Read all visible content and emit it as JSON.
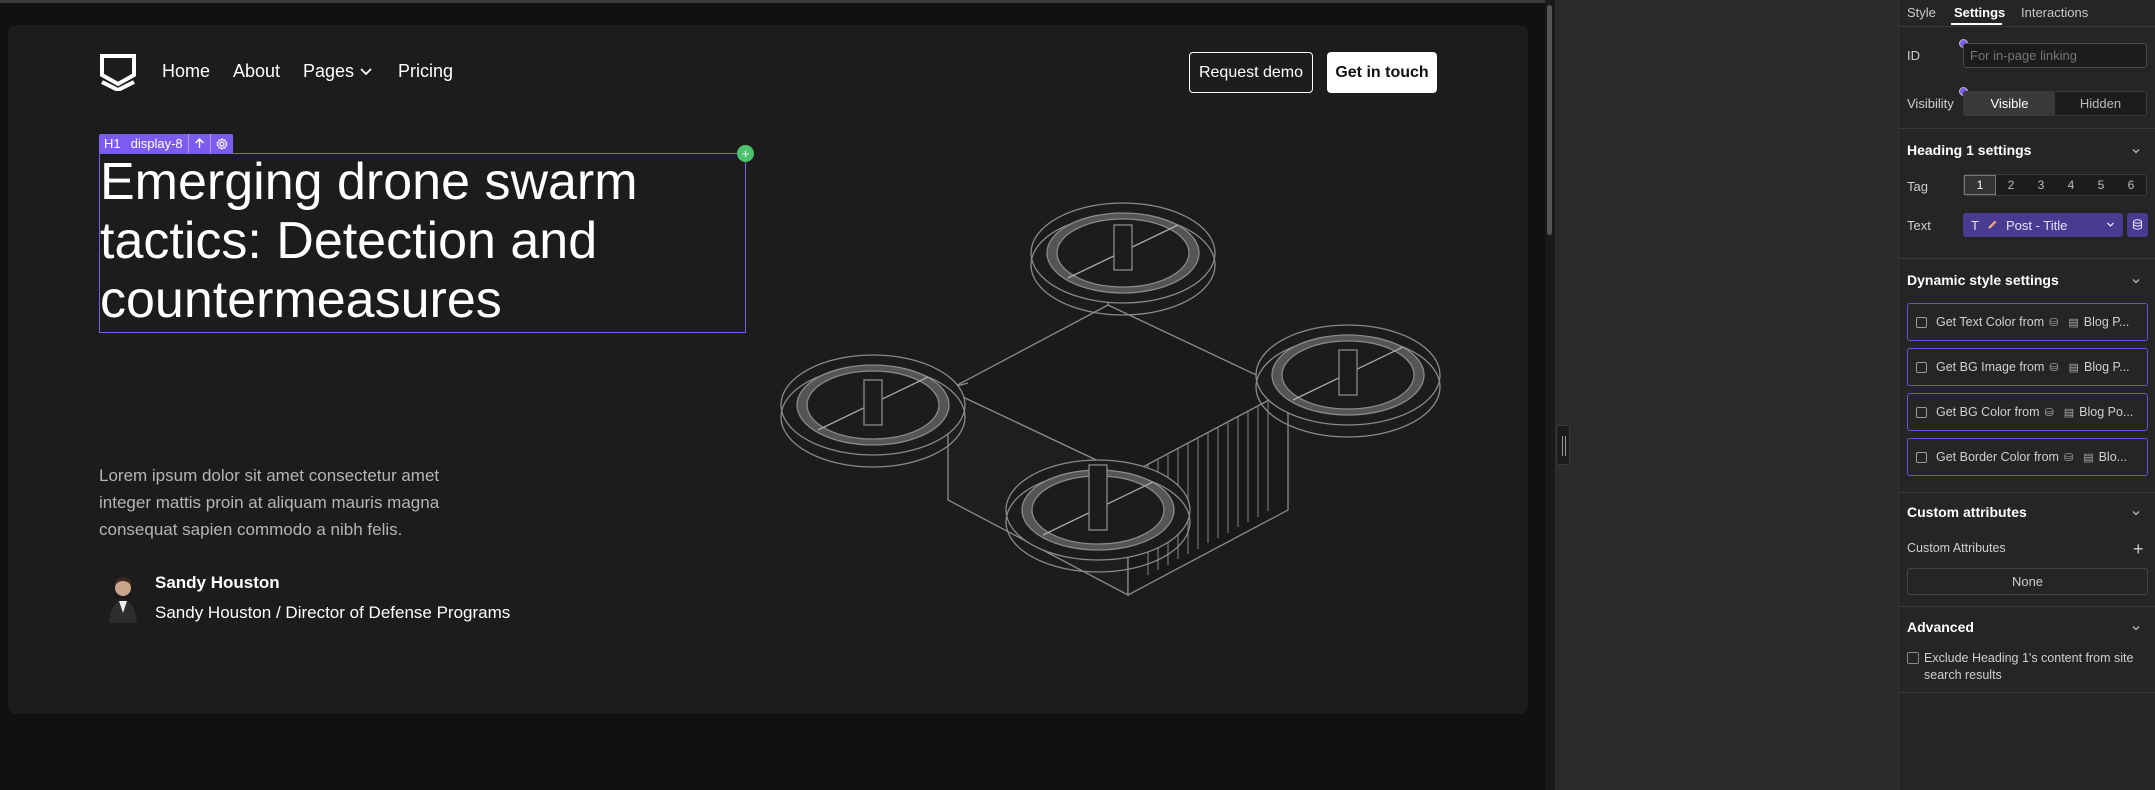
{
  "nav": {
    "links": [
      "Home",
      "About",
      "Pages",
      "Pricing"
    ],
    "request_demo": "Request demo",
    "get_in_touch": "Get in touch"
  },
  "selection": {
    "tag": "H1",
    "class_name": "display-8",
    "add_symbol": "+"
  },
  "hero": {
    "title": "Emerging drone swarm tactics: Detection and countermeasures",
    "body": "Lorem ipsum dolor sit amet consectetur amet integer mattis proin at aliquam mauris magna consequat sapien commodo a nibh felis.",
    "author_name": "Sandy Houston",
    "author_role": "Sandy Houston / Director of Defense Programs"
  },
  "panel": {
    "tabs": [
      "Style",
      "Settings",
      "Interactions"
    ],
    "active_tab": "Settings",
    "id_label": "ID",
    "id_placeholder": "For in-page linking",
    "visibility_label": "Visibility",
    "visibility_options": [
      "Visible",
      "Hidden"
    ],
    "heading_section": "Heading 1 settings",
    "tag_label": "Tag",
    "tag_options": [
      "1",
      "2",
      "3",
      "4",
      "5",
      "6"
    ],
    "text_label": "Text",
    "text_type_icon": "T",
    "text_binding": "Post - Title",
    "dynamic_section": "Dynamic style settings",
    "dynamic_items": [
      {
        "label": "Get Text Color from",
        "source": "Blog P..."
      },
      {
        "label": "Get BG Image from",
        "source": "Blog P..."
      },
      {
        "label": "Get BG Color from",
        "source": "Blog Po..."
      },
      {
        "label": "Get Border Color from",
        "source": "Blo..."
      }
    ],
    "custom_attr_section": "Custom attributes",
    "custom_attr_label": "Custom Attributes",
    "custom_attr_value": "None",
    "advanced_section": "Advanced",
    "exclude_text": "Exclude Heading 1's content from site search results"
  },
  "colors": {
    "accent": "#7c5cf0",
    "canvas_bg": "#1c1c1c",
    "panel_bg": "#252525",
    "add_dot": "#4cc26f"
  }
}
